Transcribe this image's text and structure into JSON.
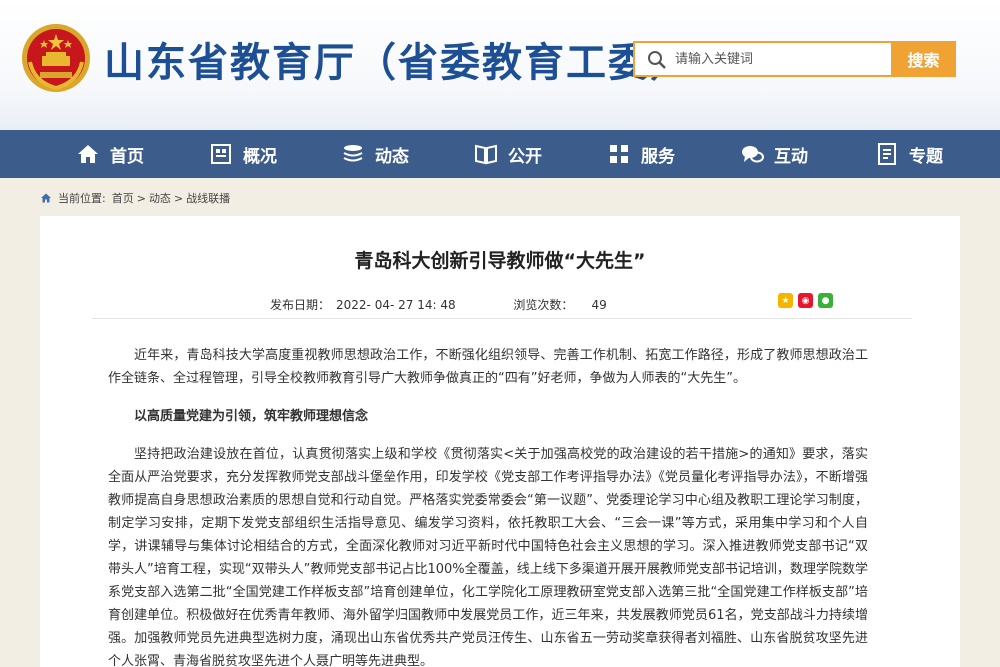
{
  "header": {
    "site_title": "山东省教育厅（省委教育工委）",
    "emblem_icon": "national-emblem-icon",
    "search_placeholder": "请输入关键词",
    "search_button": "搜索",
    "accent_color": "#f0a232",
    "brand_color": "#1d4f95"
  },
  "nav": {
    "background_color": "#3c5d8c",
    "items": [
      {
        "label": "首页",
        "icon": "home-icon"
      },
      {
        "label": "概况",
        "icon": "building-icon"
      },
      {
        "label": "动态",
        "icon": "stack-icon"
      },
      {
        "label": "公开",
        "icon": "book-icon"
      },
      {
        "label": "服务",
        "icon": "grid-icon"
      },
      {
        "label": "互动",
        "icon": "chat-icon"
      },
      {
        "label": "专题",
        "icon": "document-icon"
      }
    ]
  },
  "breadcrumb": {
    "prefix": "当前位置:",
    "items": [
      "首页",
      "动态",
      "战线联播"
    ],
    "separator": ">"
  },
  "article": {
    "title": "青岛科大创新引导教师做“大先生”",
    "publish_label": "发布日期：",
    "publish_date": "2022- 04- 27 14: 48",
    "views_label": "浏览次数：",
    "views": "49",
    "share_icons": [
      "qzone-share-icon",
      "weibo-share-icon",
      "wechat-share-icon"
    ],
    "paragraph_1": "近年来，青岛科技大学高度重视教师思想政治工作，不断强化组织领导、完善工作机制、拓宽工作路径，形成了教师思想政治工作全链条、全过程管理，引导全校教师教育引导广大教师争做真正的“四有”好老师，争做为人师表的“大先生”。",
    "subheading_1": "以高质量党建为引领，筑牢教师理想信念",
    "paragraph_2": "坚持把政治建设放在首位，认真贯彻落实上级和学校《贯彻落实<关于加强高校党的政治建设的若干措施>的通知》要求，落实全面从严治党要求，充分发挥教师党支部战斗堡垒作用，印发学校《党支部工作考评指导办法》《党员量化考评指导办法》，不断增强教师提高自身思想政治素质的思想自觉和行动自觉。严格落实党委常委会“第一议题”、党委理论学习中心组及教职工理论学习制度，制定学习安排，定期下发党支部组织生活指导意见、编发学习资料，依托教职工大会、“三会一课”等方式，采用集中学习和个人自学，讲课辅导与集体讨论相结合的方式，全面深化教师对习近平新时代中国特色社会主义思想的学习。深入推进教师党支部书记“双带头人”培育工程，实现“双带头人”教师党支部书记占比100%全覆盖，线上线下多渠道开展开展教师党支部书记培训，数理学院数学系党支部入选第二批“全国党建工作样板支部”培育创建单位，化工学院化工原理教研室党支部入选第三批“全国党建工作样板支部”培育创建单位。积极做好在优秀青年教师、海外留学归国教师中发展党员工作，近三年来，共发展教师党员61名，党支部战斗力持续增强。加强教师党员先进典型选树力度，涌现出山东省优秀共产党员汪传生、山东省五一劳动奖章获得者刘福胜、山东省脱贫攻坚先进个人张霄、青海省脱贫攻坚先进个人聂广明等先进典型。"
  }
}
